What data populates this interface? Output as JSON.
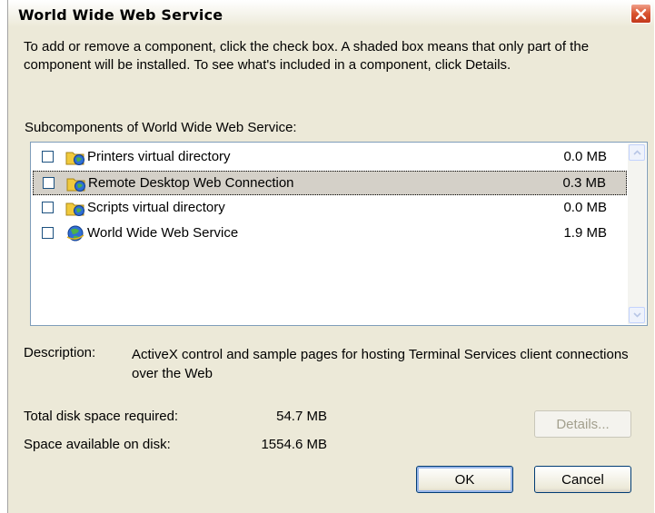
{
  "window": {
    "title": "World Wide Web Service"
  },
  "intro_text": "To add or remove a component, click the check box. A shaded box means that only part of the component will be installed. To see what's included in a component, click Details.",
  "subcomponents_label": "Subcomponents of World Wide Web Service:",
  "components": [
    {
      "label": "Printers virtual directory",
      "size": "0.0 MB",
      "checked": false,
      "icon": "folder-globe-icon"
    },
    {
      "label": "Remote Desktop Web Connection",
      "size": "0.3 MB",
      "checked": false,
      "icon": "folder-globe-icon",
      "selected": true
    },
    {
      "label": "Scripts virtual directory",
      "size": "0.0 MB",
      "checked": false,
      "icon": "folder-globe-icon"
    },
    {
      "label": "World Wide Web Service",
      "size": "1.9 MB",
      "checked": false,
      "icon": "globe-icon"
    }
  ],
  "description": {
    "label": "Description:",
    "text": "ActiveX control and sample pages for hosting Terminal Services client connections over the Web"
  },
  "disk": {
    "required_label": "Total disk space required:",
    "required_value": "54.7 MB",
    "available_label": "Space available on disk:",
    "available_value": "1554.6 MB"
  },
  "buttons": {
    "details": "Details...",
    "ok": "OK",
    "cancel": "Cancel"
  },
  "colors": {
    "dialog_bg": "#ece9d8",
    "close_red": "#d9532f",
    "selection": "#d4d0c8"
  }
}
